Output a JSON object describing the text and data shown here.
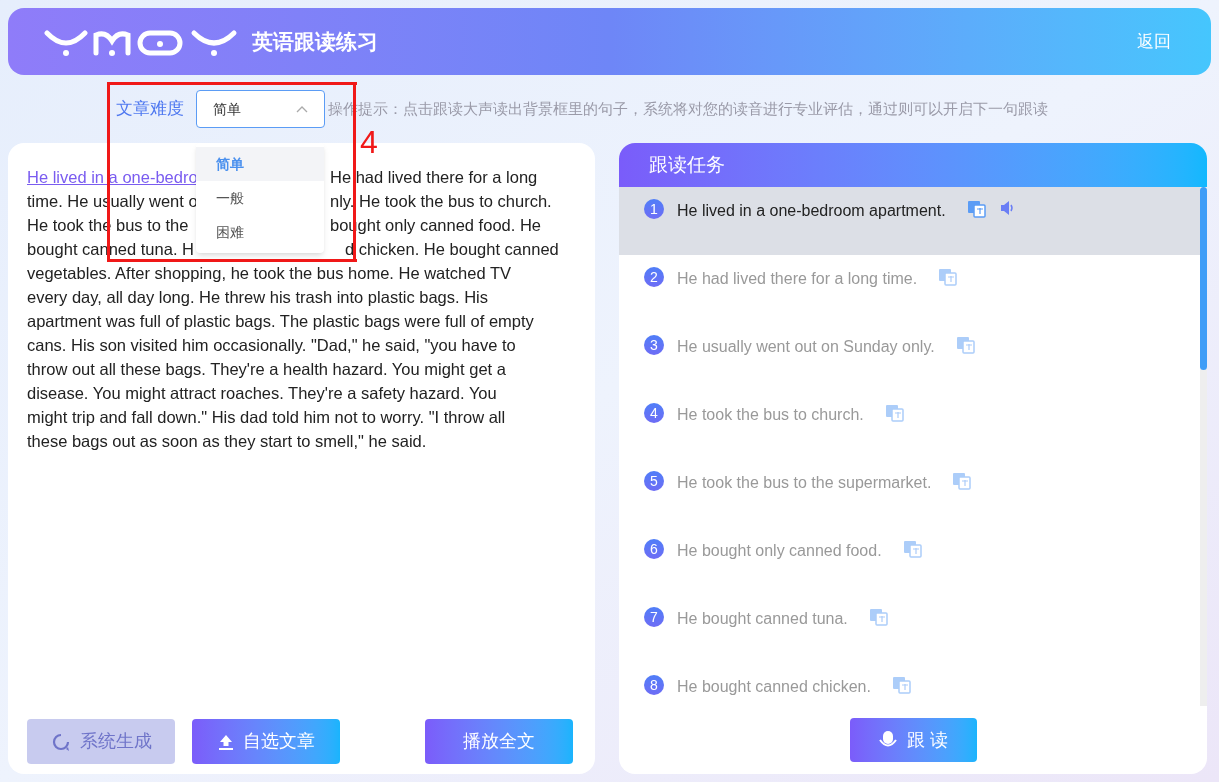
{
  "header": {
    "title": "英语跟读练习",
    "back": "返回"
  },
  "difficulty": {
    "label": "文章难度",
    "value": "简单",
    "expanded": true,
    "options": [
      {
        "label": "简单",
        "selected": true
      },
      {
        "label": "一般",
        "selected": false
      },
      {
        "label": "困难",
        "selected": false
      }
    ]
  },
  "hint": "操作提示：点击跟读大声读出背景框里的句子，系统将对您的读音进行专业评估，通过则可以开启下一句跟读",
  "annotation": {
    "label": "4"
  },
  "passage": {
    "lines": [
      {
        "segments": [
          {
            "text": "He lived in a one-bedro",
            "highlighted": true
          },
          {
            "text": "He had lived there for a long",
            "highlighted": false
          }
        ]
      },
      {
        "segments": [
          {
            "text": "time. He usually went o",
            "highlighted": false
          },
          {
            "text": "nly. He took the bus to church.",
            "highlighted": false
          }
        ]
      },
      {
        "segments": [
          {
            "text": "He took the bus to the",
            "highlighted": false
          },
          {
            "text": "bought only canned food. He",
            "highlighted": false
          }
        ]
      },
      {
        "segments": [
          {
            "text": "bought canned tuna. H",
            "highlighted": false
          },
          {
            "text": "d chicken. He bought canned",
            "highlighted": false
          }
        ]
      }
    ],
    "rest": "vegetables. After shopping, he took the bus home. He watched TV every day, all day long. He threw his trash into plastic bags. His apartment was full of plastic bags. The plastic bags were full of empty cans. His son visited him occasionally. \"Dad,\" he said, \"you have to throw out all these bags. They're a health hazard. You might get a disease. You might attract roaches. They're a safety hazard. You might trip and fall down.\" His dad told him not to worry. \"I throw all these bags out as soon as they start to smell,\" he said."
  },
  "left_buttons": [
    {
      "label": "系统生成",
      "disabled": true
    },
    {
      "label": "自选文章",
      "disabled": false
    }
  ],
  "play_all": "播放全文",
  "tasks": {
    "title": "跟读任务",
    "items": [
      {
        "number": "1",
        "text": "He lived in a one-bedroom apartment.",
        "selected": true
      },
      {
        "number": "2",
        "text": "He had lived there for a long time.",
        "selected": false
      },
      {
        "number": "3",
        "text": "He usually went out on Sunday only.",
        "selected": false
      },
      {
        "number": "4",
        "text": "He took the bus to church.",
        "selected": false
      },
      {
        "number": "5",
        "text": "He took the bus to the supermarket.",
        "selected": false
      },
      {
        "number": "6",
        "text": "He bought only canned food.",
        "selected": false
      },
      {
        "number": "7",
        "text": "He bought canned tuna.",
        "selected": false
      },
      {
        "number": "8",
        "text": "He bought canned chicken.",
        "selected": false
      }
    ]
  },
  "follow_button": "跟 读"
}
